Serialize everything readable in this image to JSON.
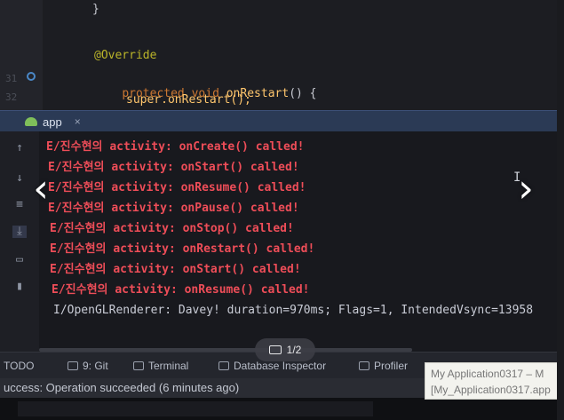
{
  "editor": {
    "lines": [
      {
        "num": "",
        "text": "}"
      },
      {
        "num": "",
        "text": ""
      },
      {
        "num": "",
        "annotation": "@Override"
      },
      {
        "num": "31",
        "kw1": "protected",
        "kw2": "void",
        "fn": "onRestart",
        "rest": "() {"
      },
      {
        "num": "32",
        "text": "super.onRestart();"
      }
    ]
  },
  "run_panel": {
    "tab_label": "app",
    "tab_close": "×"
  },
  "console": {
    "lines": [
      {
        "tag": "E/진수현의",
        "message": "activity: onCreate() called!",
        "level": "error"
      },
      {
        "tag": "E/진수현의",
        "message": "activity: onStart() called!",
        "level": "error"
      },
      {
        "tag": "E/진수현의",
        "message": "activity: onResume() called!",
        "level": "error"
      },
      {
        "tag": "E/진수현의",
        "message": "activity: onPause() called!",
        "level": "error"
      },
      {
        "tag": "E/진수현의",
        "message": "activity: onStop() called!",
        "level": "error"
      },
      {
        "tag": "E/진수현의",
        "message": "activity: onRestart() called!",
        "level": "error"
      },
      {
        "tag": "E/진수현의",
        "message": "activity: onStart() called!",
        "level": "error"
      },
      {
        "tag": "E/진수현의",
        "message": "activity: onResume() called!",
        "level": "error"
      },
      {
        "tag": "I/OpenGLRenderer:",
        "message": "Davey! duration=970ms; Flags=1, IntendedVsync=13958",
        "level": "info"
      }
    ]
  },
  "bottom_tools": {
    "todo": "TODO",
    "git": "9: Git",
    "terminal": "Terminal",
    "database": "Database Inspector",
    "profiler": "Profiler"
  },
  "status": {
    "message": "uccess: Operation succeeded (6 minutes ago)"
  },
  "tooltip": {
    "line1": "My Application0317 – M",
    "line2": "[My_Application0317.app"
  },
  "viewer": {
    "prev_icon": "chevron-left",
    "next_icon": "chevron-right",
    "pager": "1/2"
  },
  "colors": {
    "error": "#ee4d58",
    "info": "#c9ccd6",
    "keyword": "#cc7832",
    "annotation": "#bbb529",
    "function": "#ffc66d"
  }
}
